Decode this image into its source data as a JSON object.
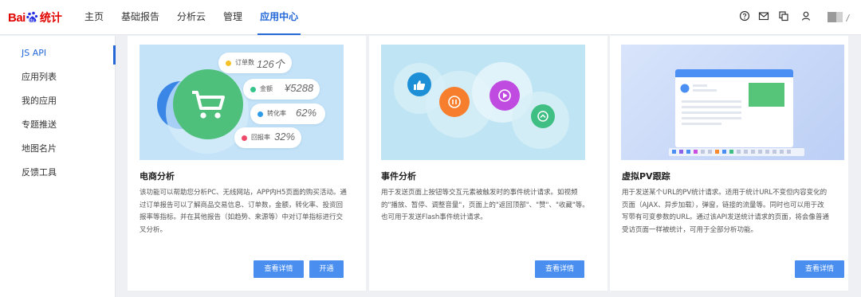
{
  "header": {
    "logo_text": "Bai",
    "logo_text2": "统计",
    "nav": [
      {
        "label": "主页"
      },
      {
        "label": "基础报告"
      },
      {
        "label": "分析云"
      },
      {
        "label": "管理"
      },
      {
        "label": "应用中心"
      }
    ],
    "active_nav": "应用中心",
    "tools": [
      "help-icon",
      "mail-icon",
      "copy-icon",
      "user-icon"
    ]
  },
  "sidebar": {
    "items": [
      {
        "label": "JS API"
      },
      {
        "label": "应用列表"
      },
      {
        "label": "我的应用"
      },
      {
        "label": "专题推送"
      },
      {
        "label": "地图名片"
      },
      {
        "label": "反馈工具"
      }
    ],
    "active": "JS API"
  },
  "cards": [
    {
      "title": "电商分析",
      "description": "该功能可以帮助您分析PC、无线网站，APP内H5页面的购买活动。通过订单报告可以了解商品交易信息、订单数，金额，转化率、投资回报率等指标。并在其他报告（如趋势、来源等）中对订单指标进行交叉分析。",
      "buttons": [
        "查看详情",
        "开通"
      ],
      "illustration": {
        "metrics": [
          {
            "label": "订单数",
            "value": "126个"
          },
          {
            "label": "金额",
            "value": "¥5288"
          },
          {
            "label": "转化率",
            "value": "62%"
          },
          {
            "label": "回报率",
            "value": "32%"
          }
        ]
      }
    },
    {
      "title": "事件分析",
      "description": "用于发送页面上按钮等交互元素被触发时的事件统计请求。如视频的\"播放、暂停、调整音量\"，页面上的\"返回顶部\"、\"赞\"、\"收藏\"等。也可用于发送Flash事件统计请求。",
      "buttons": [
        "查看详情"
      ]
    },
    {
      "title": "虚拟PV跟踪",
      "description": "用于发送某个URL的PV统计请求。适用于统计URL不变但内容变化的页面（AJAX、异步加载），弹窗，链接的流量等。同时也可以用于改写带有可变参数的URL。通过该API发送统计请求的页面，将会像普通受访页面一样被统计，可用于全部分析功能。",
      "buttons": [
        "查看详情"
      ]
    }
  ],
  "colors": {
    "accent": "#2468d8",
    "button": "#4a8ff0",
    "logo_red": "#e10602",
    "logo_blue": "#2932e1"
  }
}
